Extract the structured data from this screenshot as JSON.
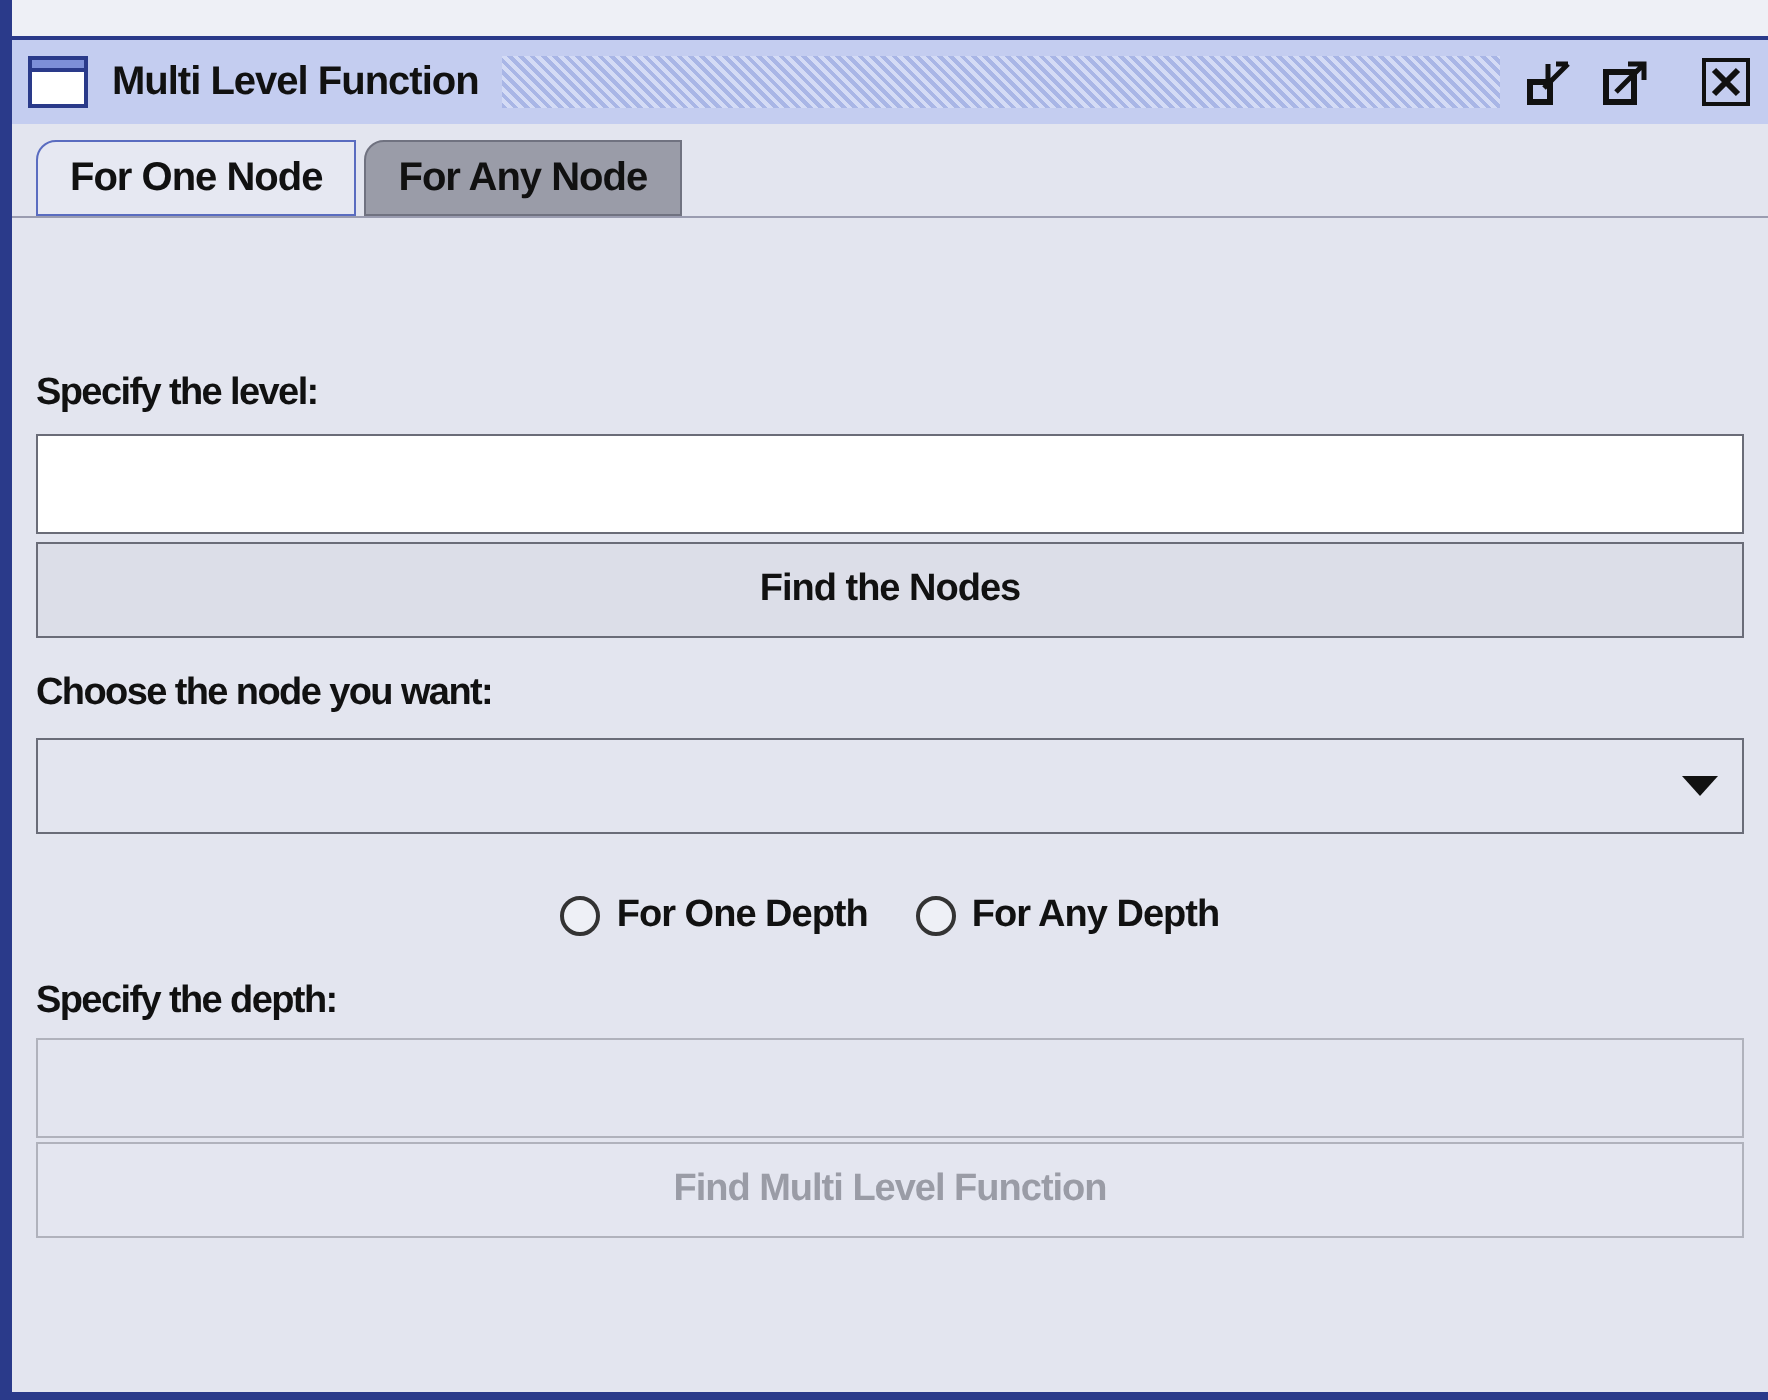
{
  "window": {
    "title": "Multi Level Function"
  },
  "tabs": [
    {
      "label": "For One Node",
      "selected": true
    },
    {
      "label": "For Any Node",
      "selected": false
    }
  ],
  "level": {
    "label": "Specify the level:"
  },
  "find_nodes_button": {
    "label": "Find the Nodes",
    "disabled": false
  },
  "node": {
    "label": "Choose the node you want:"
  },
  "depth_options": [
    {
      "label": "For One Depth",
      "selected": false
    },
    {
      "label": "For Any Depth",
      "selected": false
    }
  ],
  "depth": {
    "label": "Specify the depth:",
    "disabled": true
  },
  "find_function_button": {
    "label": "Find Multi Level Function",
    "disabled": true
  }
}
